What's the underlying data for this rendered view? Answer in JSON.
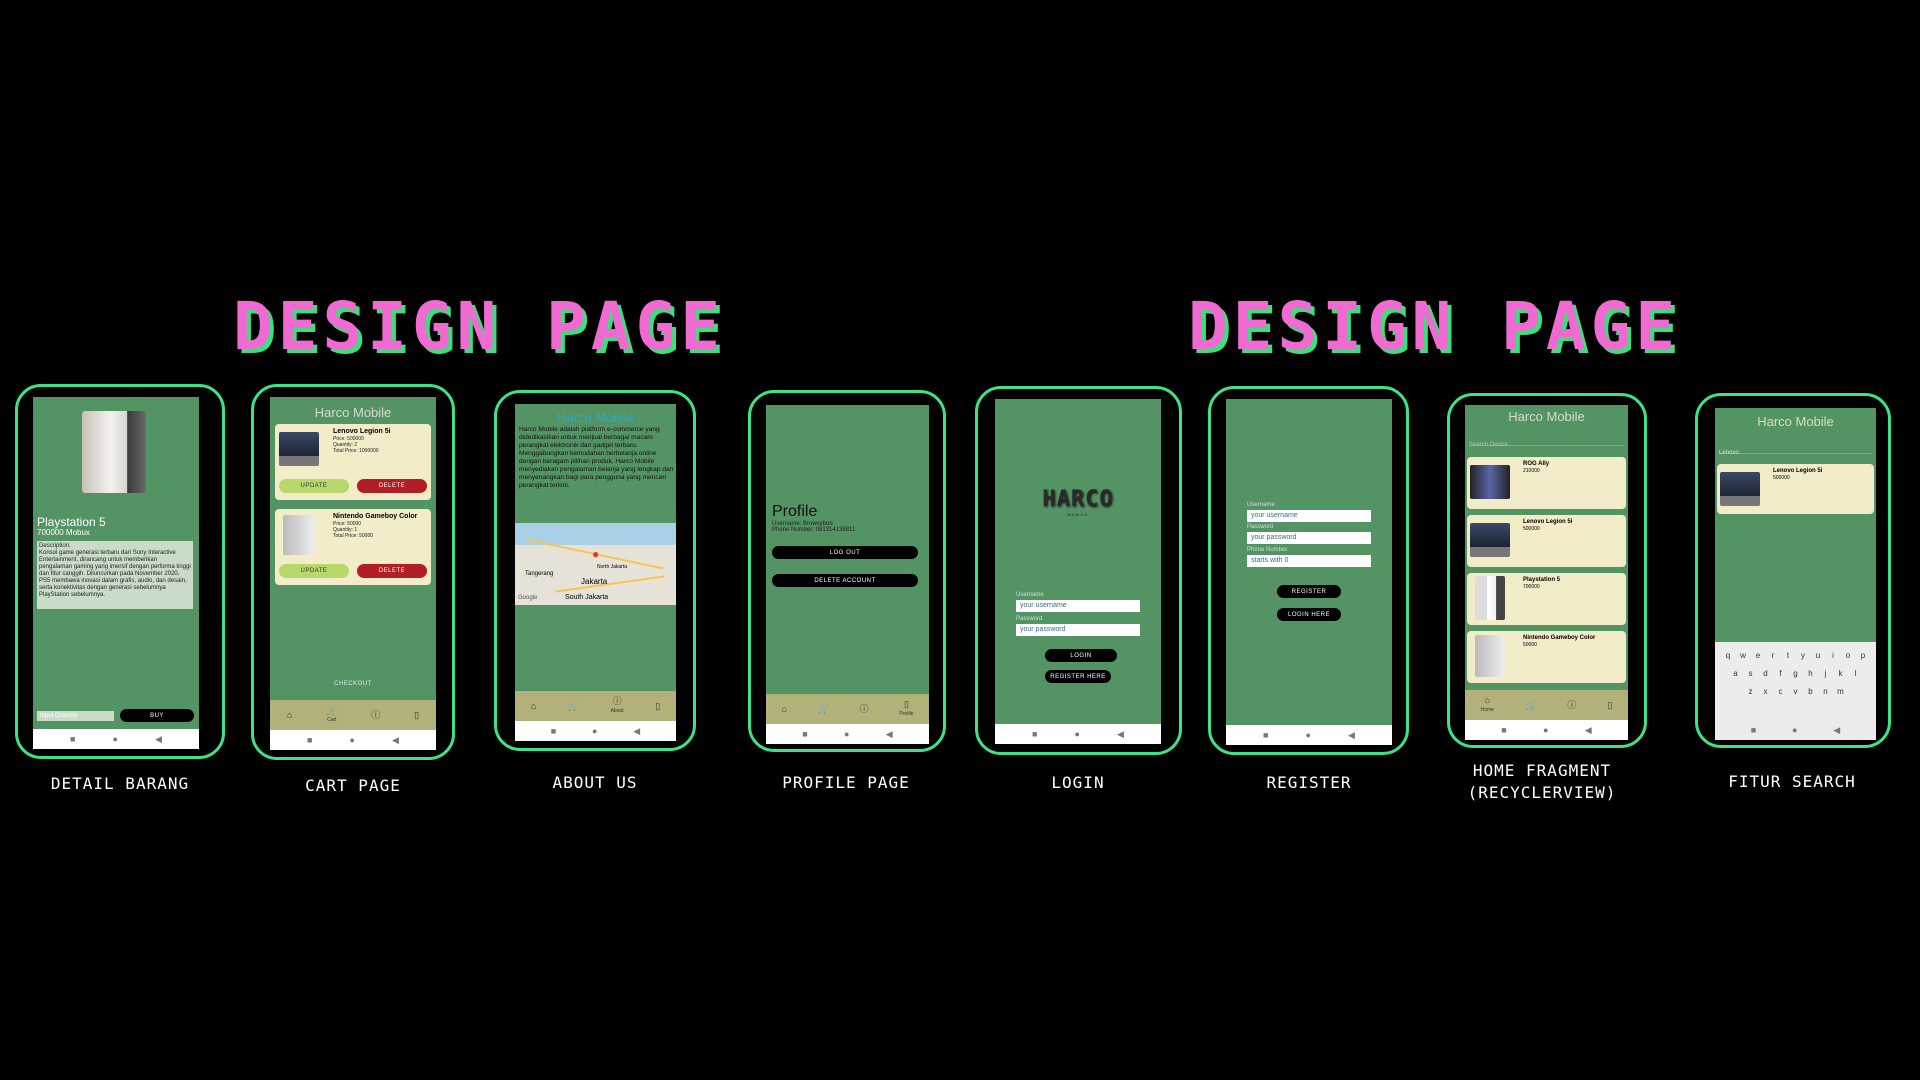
{
  "headings": [
    "DESIGN PAGE",
    "DESIGN PAGE"
  ],
  "captions": {
    "detail": "DETAIL BARANG",
    "cart": "CART PAGE",
    "about": "ABOUT US",
    "profile": "PROFILE PAGE",
    "login": "LOGIN",
    "register": "REGISTER",
    "home": "HOME FRAGMENT (RECYCLERVIEW)",
    "search": "FITUR SEARCH"
  },
  "app_title": "Harco Mobile",
  "detail": {
    "product_name": "Playstation 5",
    "price": "700000 Mobux",
    "description": "Description:\nKonsol game generasi terbaru dari Sony Interactive Entertainment, dirancang untuk memberikan pengalaman gaming yang imersif dengan performa tinggi dan fitur canggih. Diluncurkan pada November 2020, PS5 membawa inovasi dalam grafis, audio, dan desain, serta konektivitas dengan generasi sebelumnya PlayStation sebelumnya.",
    "quantity_placeholder": "Input Quantity",
    "buy_label": "BUY"
  },
  "cart": {
    "items": [
      {
        "name": "Lenovo Legion 5i",
        "price": "Price: 500000",
        "quantity": "Quantity: 2",
        "total": "Total Price: 1000000"
      },
      {
        "name": "Nintendo Gameboy Color",
        "price": "Price: 50000",
        "quantity": "Quantity: 1",
        "total": "Total Price: 50000"
      }
    ],
    "update_label": "UPDATE",
    "delete_label": "DELETE",
    "checkout_label": "CHECKOUT"
  },
  "about": {
    "text": "Harco Mobile adalah platform e-commerce yang didedikasikan untuk menjual berbagai macam perangkat elektronik dan gadget terbaru. Menggabungkan kemudahan berbelanja online dengan beragam pilihan produk, Harco Mobile menyediakan pengalaman belanja yang lengkap dan menyenangkan bagi para pengguna yang mencari perangkat terkini.",
    "map_labels": [
      "Jakarta",
      "North Jakarta",
      "South Jakarta",
      "Tangerang",
      "Google"
    ]
  },
  "profile": {
    "title": "Profile",
    "username": "Username: Browsyboo",
    "phone": "Phone Number: 081314138811",
    "logout_label": "LOG OUT",
    "delete_label": "DELETE ACCOUNT"
  },
  "login": {
    "logo": "HARCO",
    "logo_sub": "MOBILE",
    "username_label": "Username",
    "username_placeholder": "your username",
    "password_label": "Password",
    "password_placeholder": "your password",
    "login_label": "LOGIN",
    "register_label": "REGISTER HERE"
  },
  "register": {
    "username_label": "Username",
    "username_placeholder": "your username",
    "password_label": "Password",
    "password_placeholder": "your password",
    "phone_label": "Phone Number",
    "phone_placeholder": "starts with 0",
    "register_label": "REGISTER",
    "login_label": "LOGIN HERE"
  },
  "home": {
    "search_placeholder": "Search Device",
    "items": [
      {
        "name": "ROG Ally",
        "price": "210000"
      },
      {
        "name": "Lenovo Legion 5i",
        "price": "500000"
      },
      {
        "name": "Playstation 5",
        "price": "700000"
      },
      {
        "name": "Nintendo Gameboy Color",
        "price": "50000"
      }
    ]
  },
  "search": {
    "query": "Lenovo",
    "result": {
      "name": "Lenovo Legion 5i",
      "price": "500000"
    },
    "keyboard_rows": [
      "qwertyuiop",
      "asdfghjkl",
      "zxcvbnm"
    ]
  },
  "nav_labels": {
    "cart": "Cart",
    "about": "About",
    "profile": "Profile",
    "home": "Home"
  },
  "colors": {
    "screen": "#549364",
    "card": "#f3ecc9",
    "heading": "#f06ad2",
    "frame": "#3ce38a"
  }
}
